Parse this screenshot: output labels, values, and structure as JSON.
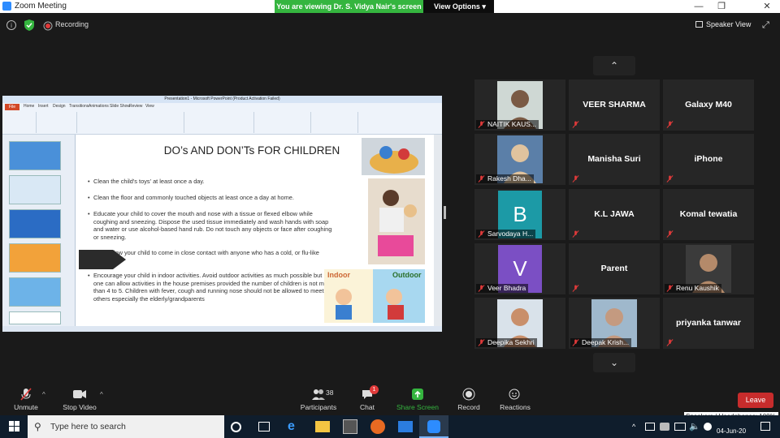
{
  "window": {
    "title": "Zoom Meeting"
  },
  "banner": {
    "viewing_text": "You are viewing Dr. S. Vidya Nair's screen",
    "view_options_label": "View Options"
  },
  "top": {
    "recording_label": "Recording",
    "speaker_view_label": "Speaker View"
  },
  "shared_screen": {
    "slide_title": "DO’s AND DON’Ts FOR CHILDREN",
    "bullets": [
      "Clean the child's toys' at least once a day.",
      "Clean the floor and commonly touched objects at least once a day at home.",
      "Educate your child to cover the mouth and nose with a tissue or flexed elbow while coughing and sneezing. Dispose the used tissue immediately and wash hands with soap and water or use alcohol-based hand rub. Do not touch any objects or face after coughing or sneezing.",
      "Don't allow your child to come in close contact with anyone who has a cold, or flu-like symptoms",
      "Encourage your child in indoor activities. Avoid outdoor activities as much possible but one can allow activities in the house premises provided the number of children is not more than 4 to 5. Children with fever, cough and running nose should not be allowed to meet others especially the elderly/grandparents"
    ],
    "indoor_label": "Indoor",
    "outdoor_label": "Outdoor"
  },
  "participants": [
    {
      "name": "NAITIK KAUS...",
      "kind": "photo"
    },
    {
      "name": "VEER    SHARMA",
      "kind": "text"
    },
    {
      "name": "Galaxy M40",
      "kind": "text"
    },
    {
      "name": "Rakesh Dha...",
      "kind": "photo"
    },
    {
      "name": "Manisha Suri",
      "kind": "text"
    },
    {
      "name": "iPhone",
      "kind": "text"
    },
    {
      "name": "Sarvodaya H...",
      "kind": "letter",
      "letter": "B",
      "color": "#1c9aa6"
    },
    {
      "name": "K.L JAWA",
      "kind": "text"
    },
    {
      "name": "Komal tewatia",
      "kind": "text"
    },
    {
      "name": "Veer Bhadra",
      "kind": "letter",
      "letter": "V",
      "color": "#7b4fc4"
    },
    {
      "name": "Parent",
      "kind": "text"
    },
    {
      "name": "Renu Kaushik",
      "kind": "photo"
    },
    {
      "name": "Deepika Sekhri",
      "kind": "photo"
    },
    {
      "name": "Deepak Krish...",
      "kind": "photo"
    },
    {
      "name": "priyanka tanwar",
      "kind": "text"
    }
  ],
  "toolbar": {
    "unmute": "Unmute",
    "stop_video": "Stop Video",
    "participants": "Participants",
    "participants_count": "38",
    "chat": "Chat",
    "chat_badge": "1",
    "share_screen": "Share Screen",
    "record": "Record",
    "reactions": "Reactions",
    "leave": "Leave",
    "speakers_tooltip": "Speakers / Headphones: 100%"
  },
  "taskbar": {
    "search_placeholder": "Type here to search",
    "time": "",
    "date": "04-Jun-20"
  },
  "colors": {
    "share_green": "#35b53f",
    "leave_red": "#c72c2c",
    "zoom_blue": "#2d8cff"
  }
}
